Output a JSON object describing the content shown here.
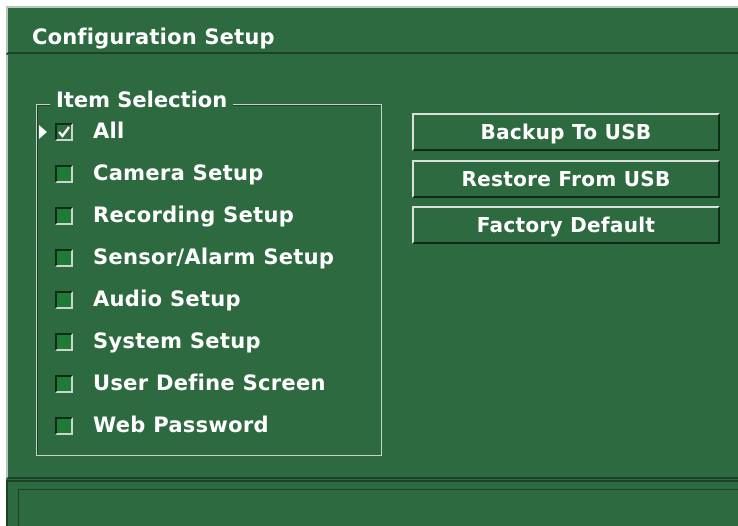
{
  "window": {
    "title": "Configuration Setup"
  },
  "item_selection": {
    "legend": "Item Selection",
    "items": [
      {
        "label": "All",
        "checked": true,
        "focused": true
      },
      {
        "label": "Camera Setup",
        "checked": false,
        "focused": false
      },
      {
        "label": "Recording Setup",
        "checked": false,
        "focused": false
      },
      {
        "label": "Sensor/Alarm Setup",
        "checked": false,
        "focused": false
      },
      {
        "label": "Audio Setup",
        "checked": false,
        "focused": false
      },
      {
        "label": "System Setup",
        "checked": false,
        "focused": false
      },
      {
        "label": "User Define Screen",
        "checked": false,
        "focused": false
      },
      {
        "label": "Web Password",
        "checked": false,
        "focused": false
      }
    ]
  },
  "actions": {
    "backup_label": "Backup To USB",
    "restore_label": "Restore From USB",
    "factory_label": "Factory Default"
  },
  "status_bar": {
    "text": ""
  },
  "colors": {
    "background": "#2e6a40",
    "checkbox_fill": "#1f7a36",
    "text": "#ffffff"
  },
  "icons": {
    "focus_cursor": "triangle-right-icon",
    "checkmark": "checkmark-icon"
  }
}
